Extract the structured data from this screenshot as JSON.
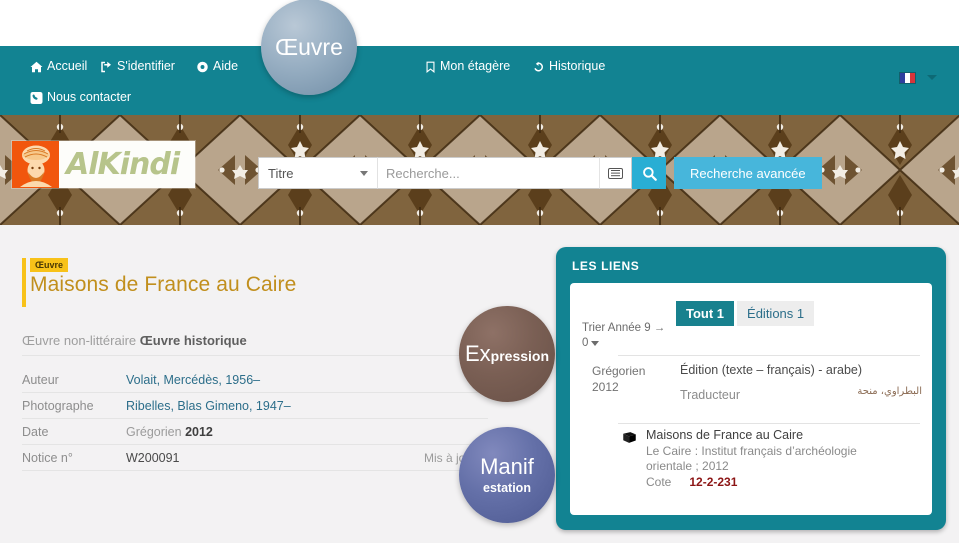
{
  "navbar": {
    "items": [
      {
        "label": "Accueil",
        "icon": "home-icon"
      },
      {
        "label": "S'identifier",
        "icon": "sign-in-icon"
      },
      {
        "label": "Aide",
        "icon": "help-ring-icon"
      },
      {
        "label": "Mon étagère",
        "icon": "bookmark-icon"
      },
      {
        "label": "Historique",
        "icon": "history-icon"
      },
      {
        "label": "Nous contacter",
        "icon": "phone-square-icon"
      }
    ],
    "language_flag": "french-flag-icon",
    "bg_color": "#128392"
  },
  "brand": {
    "name": "AlKindi",
    "logo_square_color": "#f1560d",
    "text_color": "#b7c48b"
  },
  "search": {
    "field_selector": "Titre",
    "placeholder": "Recherche...",
    "keyboard_icon": "virtual-keyboard-icon",
    "search_icon": "magnifier-icon",
    "advanced_label": "Recherche avancée",
    "advanced_color": "#47b6db"
  },
  "record": {
    "badge": "Œuvre",
    "title": "Maisons de France au Caire",
    "type_prefix": "Œuvre non-littéraire ",
    "type_strong": "Œuvre historique",
    "fields": [
      {
        "label": "Auteur",
        "value": "Volait, Mercédès, 1956–",
        "style": "link"
      },
      {
        "label": "Photographe",
        "value": "Ribelles, Blas Gimeno, 1947–",
        "style": "link"
      },
      {
        "label": "Date",
        "value": "Grégorien 2012",
        "style": "date"
      },
      {
        "label": "Notice n°",
        "value": "W200091",
        "style": "plain"
      }
    ],
    "date_calendar": "Grégorien",
    "date_year": "2012",
    "updated_label": "Mis à jour l",
    "title_color": "#c18f1d",
    "badge_color": "#f8c219"
  },
  "links_panel": {
    "heading": "LES LIENS",
    "tabs": [
      {
        "label": "Tout 1",
        "active": true
      },
      {
        "label": "Éditions 1",
        "active": false
      }
    ],
    "sort_label": "Trier Année 9 →",
    "sort_value": "0",
    "results": [
      {
        "date_calendar": "Grégorien",
        "date_year": "2012",
        "title": "Édition (texte – français) - arabe)",
        "role": "Traducteur",
        "role_agent_arabic": "البطراوي، منحة",
        "manifestation": {
          "icon": "book-icon",
          "title": "Maisons de France au Caire",
          "publication": "Le Caire : Institut français d’archéologie orientale ; 2012",
          "call_number_label": "Cote",
          "call_number": "12-2-231"
        }
      }
    ],
    "panel_color": "#128392",
    "accent_color": "#18818e",
    "call_number_color": "#8c1515"
  },
  "frbr_overlays": [
    {
      "id": "oeuvre",
      "primary": "Œuvre",
      "secondary": "",
      "color": "#8aa0b4"
    },
    {
      "id": "expression",
      "primary": "Ex",
      "secondary": "pression",
      "color": "#78605a"
    },
    {
      "id": "manifestation",
      "primary": "Manif",
      "secondary": "estation",
      "color": "#5e6aa2"
    }
  ]
}
